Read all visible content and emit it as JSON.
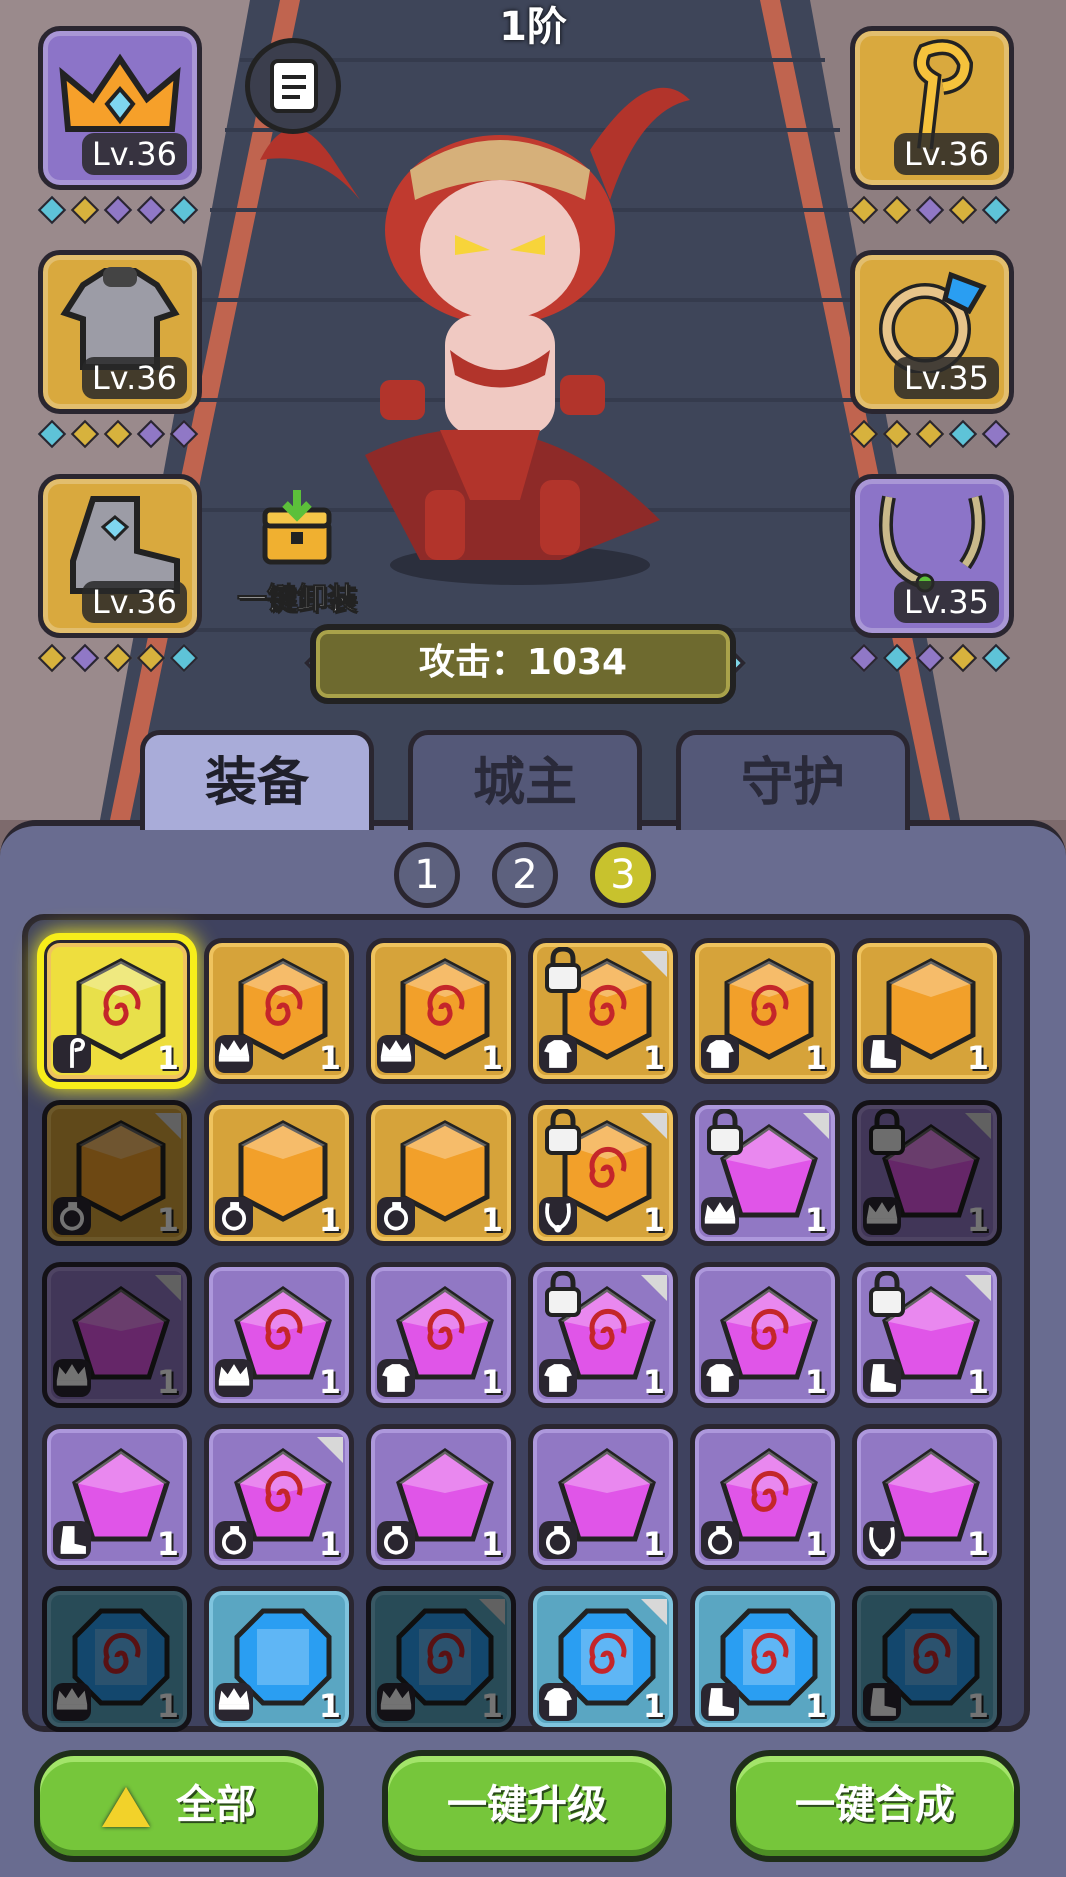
{
  "header": {
    "stage_label": "1阶"
  },
  "equip_slots": [
    {
      "name": "crown",
      "rarity": "purple",
      "level": "Lv.36",
      "gems": [
        "#5ec3d8",
        "#d7b23d",
        "#9078c6",
        "#9078c6",
        "#5ec3d8"
      ]
    },
    {
      "name": "staff",
      "rarity": "gold",
      "level": "Lv.36",
      "gems": [
        "#d7b23d",
        "#d7b23d",
        "#9078c6",
        "#d7b23d",
        "#5ec3d8"
      ]
    },
    {
      "name": "armor",
      "rarity": "gold",
      "level": "Lv.36",
      "gems": [
        "#5ec3d8",
        "#d7b23d",
        "#d7b23d",
        "#9078c6",
        "#9078c6"
      ]
    },
    {
      "name": "ring",
      "rarity": "gold",
      "level": "Lv.35",
      "gems": [
        "#d7b23d",
        "#d7b23d",
        "#d7b23d",
        "#5ec3d8",
        "#9078c6"
      ]
    },
    {
      "name": "boots",
      "rarity": "gold",
      "level": "Lv.36",
      "gems": [
        "#d7b23d",
        "#9078c6",
        "#d7b23d",
        "#d7b23d",
        "#5ec3d8"
      ]
    },
    {
      "name": "necklace",
      "rarity": "purple",
      "level": "Lv.35",
      "gems": [
        "#9078c6",
        "#5ec3d8",
        "#9078c6",
        "#d7b23d",
        "#5ec3d8"
      ]
    }
  ],
  "unequip_label": "一键卸装",
  "attack_label": "攻击：1034",
  "tabs": [
    {
      "label": "装备",
      "active": true
    },
    {
      "label": "城主",
      "active": false
    },
    {
      "label": "守护",
      "active": false
    }
  ],
  "pages": [
    {
      "label": "1",
      "selected": false
    },
    {
      "label": "2",
      "selected": false
    },
    {
      "label": "3",
      "selected": true
    }
  ],
  "inventory": [
    {
      "c": "gold",
      "s": "hex",
      "sw": true,
      "t": "staff",
      "n": "1",
      "lock": false,
      "corner": false,
      "dim": false,
      "hl": true
    },
    {
      "c": "gold",
      "s": "hex",
      "sw": true,
      "t": "crown",
      "n": "1",
      "lock": false,
      "corner": false,
      "dim": false,
      "hl": false
    },
    {
      "c": "gold",
      "s": "hex",
      "sw": true,
      "t": "crown",
      "n": "1",
      "lock": false,
      "corner": false,
      "dim": false,
      "hl": false
    },
    {
      "c": "gold",
      "s": "hex",
      "sw": true,
      "t": "armor",
      "n": "1",
      "lock": true,
      "corner": true,
      "dim": false,
      "hl": false
    },
    {
      "c": "gold",
      "s": "hex",
      "sw": true,
      "t": "armor",
      "n": "1",
      "lock": false,
      "corner": false,
      "dim": false,
      "hl": false
    },
    {
      "c": "gold",
      "s": "hex",
      "sw": false,
      "t": "boots",
      "n": "1",
      "lock": false,
      "corner": false,
      "dim": false,
      "hl": false
    },
    {
      "c": "gold",
      "s": "hex",
      "sw": false,
      "t": "ring",
      "n": "1",
      "lock": false,
      "corner": true,
      "dim": true,
      "hl": false
    },
    {
      "c": "gold",
      "s": "hex",
      "sw": false,
      "t": "ring",
      "n": "1",
      "lock": false,
      "corner": false,
      "dim": false,
      "hl": false
    },
    {
      "c": "gold",
      "s": "hex",
      "sw": false,
      "t": "ring",
      "n": "1",
      "lock": false,
      "corner": false,
      "dim": false,
      "hl": false
    },
    {
      "c": "gold",
      "s": "hex",
      "sw": true,
      "t": "necklace",
      "n": "1",
      "lock": true,
      "corner": true,
      "dim": false,
      "hl": false
    },
    {
      "c": "purple",
      "s": "pent",
      "sw": false,
      "t": "crown",
      "n": "1",
      "lock": true,
      "corner": true,
      "dim": false,
      "hl": false
    },
    {
      "c": "purple",
      "s": "pent",
      "sw": false,
      "t": "crown",
      "n": "1",
      "lock": true,
      "corner": true,
      "dim": true,
      "hl": false
    },
    {
      "c": "purple",
      "s": "pent",
      "sw": false,
      "t": "crown",
      "n": "1",
      "lock": false,
      "corner": true,
      "dim": true,
      "hl": false
    },
    {
      "c": "purple",
      "s": "pent",
      "sw": true,
      "t": "crown",
      "n": "1",
      "lock": false,
      "corner": false,
      "dim": false,
      "hl": false
    },
    {
      "c": "purple",
      "s": "pent",
      "sw": true,
      "t": "armor",
      "n": "1",
      "lock": false,
      "corner": false,
      "dim": false,
      "hl": false
    },
    {
      "c": "purple",
      "s": "pent",
      "sw": true,
      "t": "armor",
      "n": "1",
      "lock": true,
      "corner": true,
      "dim": false,
      "hl": false
    },
    {
      "c": "purple",
      "s": "pent",
      "sw": true,
      "t": "armor",
      "n": "1",
      "lock": false,
      "corner": false,
      "dim": false,
      "hl": false
    },
    {
      "c": "purple",
      "s": "pent",
      "sw": false,
      "t": "boots",
      "n": "1",
      "lock": true,
      "corner": true,
      "dim": false,
      "hl": false
    },
    {
      "c": "purple",
      "s": "pent",
      "sw": false,
      "t": "boots",
      "n": "1",
      "lock": false,
      "corner": false,
      "dim": false,
      "hl": false
    },
    {
      "c": "purple",
      "s": "pent",
      "sw": true,
      "t": "ring",
      "n": "1",
      "lock": false,
      "corner": true,
      "dim": false,
      "hl": false
    },
    {
      "c": "purple",
      "s": "pent",
      "sw": false,
      "t": "ring",
      "n": "1",
      "lock": false,
      "corner": false,
      "dim": false,
      "hl": false
    },
    {
      "c": "purple",
      "s": "pent",
      "sw": false,
      "t": "ring",
      "n": "1",
      "lock": false,
      "corner": false,
      "dim": false,
      "hl": false
    },
    {
      "c": "purple",
      "s": "pent",
      "sw": true,
      "t": "ring",
      "n": "1",
      "lock": false,
      "corner": false,
      "dim": false,
      "hl": false
    },
    {
      "c": "purple",
      "s": "pent",
      "sw": false,
      "t": "necklace",
      "n": "1",
      "lock": false,
      "corner": false,
      "dim": false,
      "hl": false
    },
    {
      "c": "blue",
      "s": "oct",
      "sw": true,
      "t": "crown",
      "n": "1",
      "lock": false,
      "corner": false,
      "dim": true,
      "hl": false
    },
    {
      "c": "blue",
      "s": "oct",
      "sw": false,
      "t": "crown",
      "n": "1",
      "lock": false,
      "corner": false,
      "dim": false,
      "hl": false
    },
    {
      "c": "blue",
      "s": "oct",
      "sw": true,
      "t": "crown",
      "n": "1",
      "lock": false,
      "corner": true,
      "dim": true,
      "hl": false
    },
    {
      "c": "blue",
      "s": "oct",
      "sw": true,
      "t": "armor",
      "n": "1",
      "lock": false,
      "corner": true,
      "dim": false,
      "hl": false
    },
    {
      "c": "blue",
      "s": "oct",
      "sw": true,
      "t": "boots",
      "n": "1",
      "lock": false,
      "corner": false,
      "dim": false,
      "hl": false
    },
    {
      "c": "blue",
      "s": "oct",
      "sw": true,
      "t": "boots",
      "n": "1",
      "lock": false,
      "corner": false,
      "dim": true,
      "hl": false
    }
  ],
  "bottom_buttons": {
    "all": "全部",
    "upgrade": "一键升级",
    "synthesize": "一键合成"
  },
  "colors": {
    "gold_gem": "#f2a02a",
    "purple_gem": "#e055e8",
    "blue_gem": "#2a9ef2",
    "highlight": "#f7ee1a"
  }
}
